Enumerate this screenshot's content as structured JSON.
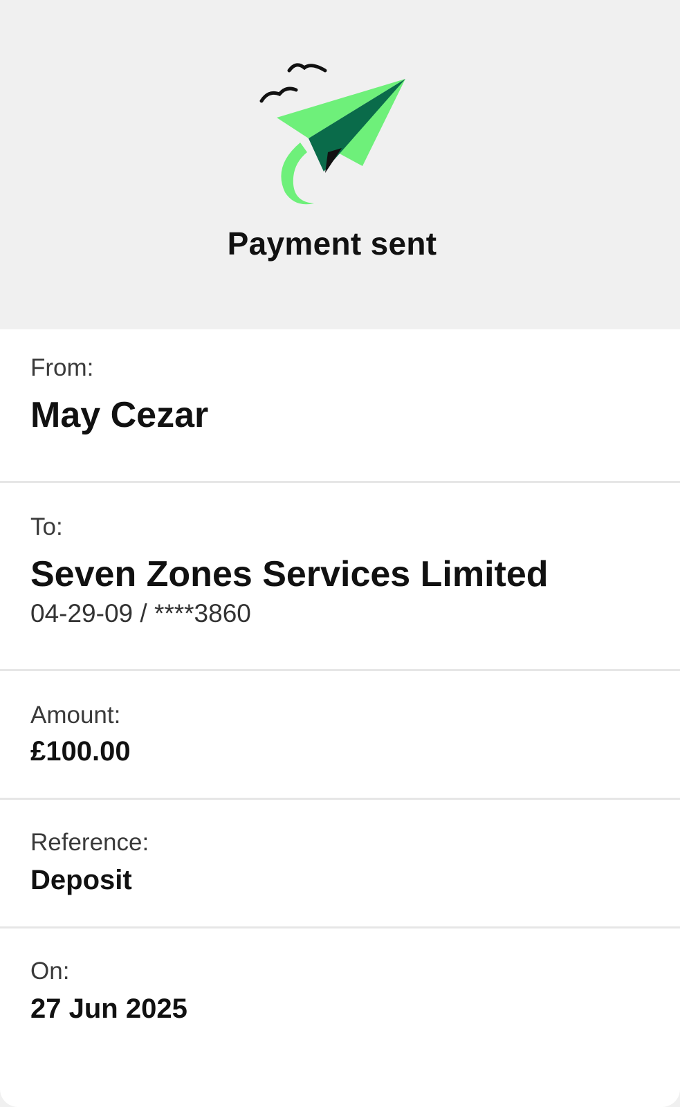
{
  "header": {
    "illustration": "paper-plane-with-birds-icon",
    "title": "Payment sent",
    "colors": {
      "background": "#f0f0f0",
      "plane_light": "#6ef07a",
      "plane_dark": "#0a6b4a",
      "ink": "#111111"
    }
  },
  "details": {
    "from": {
      "label": "From:",
      "value": "May Cezar"
    },
    "to": {
      "label": "To:",
      "value": "Seven Zones Services Limited",
      "account": "04-29-09 / ****3860"
    },
    "amount": {
      "label": "Amount:",
      "value": "£100.00"
    },
    "reference": {
      "label": "Reference:",
      "value": "Deposit"
    },
    "on": {
      "label": "On:",
      "value": "27 Jun 2025"
    }
  }
}
